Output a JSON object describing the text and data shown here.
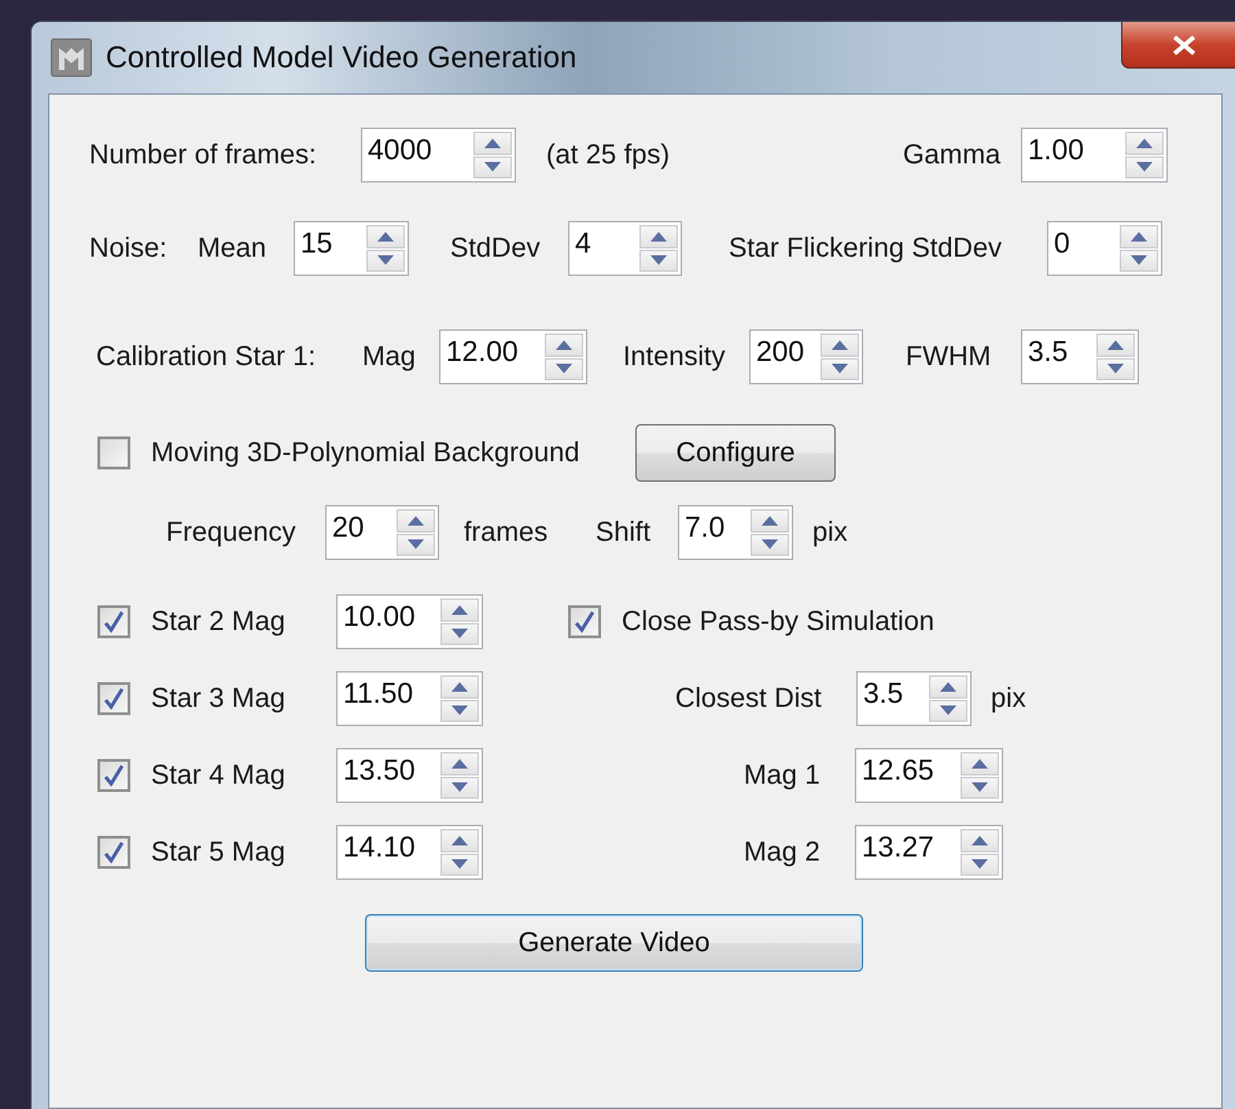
{
  "window": {
    "title": "Controlled Model Video Generation"
  },
  "frames": {
    "label": "Number of frames:",
    "value": "4000",
    "note": "(at 25 fps)"
  },
  "gamma": {
    "label": "Gamma",
    "value": "1.00"
  },
  "noise": {
    "label": "Noise:",
    "mean": {
      "label": "Mean",
      "value": "15"
    },
    "stddev": {
      "label": "StdDev",
      "value": "4"
    },
    "flickering": {
      "label": "Star Flickering StdDev",
      "value": "0"
    }
  },
  "calibration_star": {
    "label": "Calibration Star 1:",
    "mag": {
      "label": "Mag",
      "value": "12.00"
    },
    "intensity": {
      "label": "Intensity",
      "value": "200"
    },
    "fwhm": {
      "label": "FWHM",
      "value": "3.5"
    }
  },
  "background": {
    "label": "Moving 3D-Polynomial Background",
    "checked": false,
    "button": "Configure",
    "frequency": {
      "label": "Frequency",
      "value": "20",
      "unit": "frames"
    },
    "shift": {
      "label": "Shift",
      "value": "7.0",
      "unit": "pix"
    }
  },
  "stars": [
    {
      "label": "Star 2 Mag",
      "checked": true,
      "value": "10.00"
    },
    {
      "label": "Star 3 Mag",
      "checked": true,
      "value": "11.50"
    },
    {
      "label": "Star 4 Mag",
      "checked": true,
      "value": "13.50"
    },
    {
      "label": "Star 5 Mag",
      "checked": true,
      "value": "14.10"
    }
  ],
  "pass_by": {
    "label": "Close Pass-by Simulation",
    "checked": true,
    "closest_dist": {
      "label": "Closest Dist",
      "value": "3.5",
      "unit": "pix"
    },
    "mag_1": {
      "label": "Mag 1",
      "value": "12.65"
    },
    "mag_2": {
      "label": "Mag 2",
      "value": "13.27"
    }
  },
  "generate_button": "Generate Video"
}
